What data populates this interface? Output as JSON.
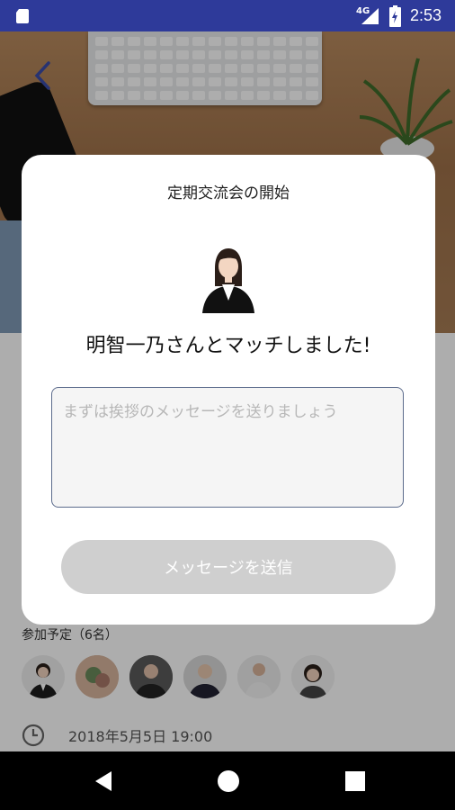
{
  "status_bar": {
    "network": "4G",
    "time": "2:53"
  },
  "modal": {
    "title": "定期交流会の開始",
    "match_text": "明智一乃さんとマッチしました!",
    "message_placeholder": "まずは挨拶のメッセージを送りましょう",
    "send_label": "メッセージを送信"
  },
  "event": {
    "participants_label": "参加予定（6名）",
    "datetime": "2018年5月5日 19:00"
  },
  "icons": [
    "sd-card-icon",
    "signal-icon",
    "battery-icon",
    "back-arrow-icon",
    "clock-icon",
    "nav-back-icon",
    "nav-home-icon",
    "nav-recents-icon"
  ],
  "colors": {
    "status_bar": "#2e3a9a",
    "accent": "#3a4ca8",
    "button_disabled": "#cfcfcf"
  }
}
